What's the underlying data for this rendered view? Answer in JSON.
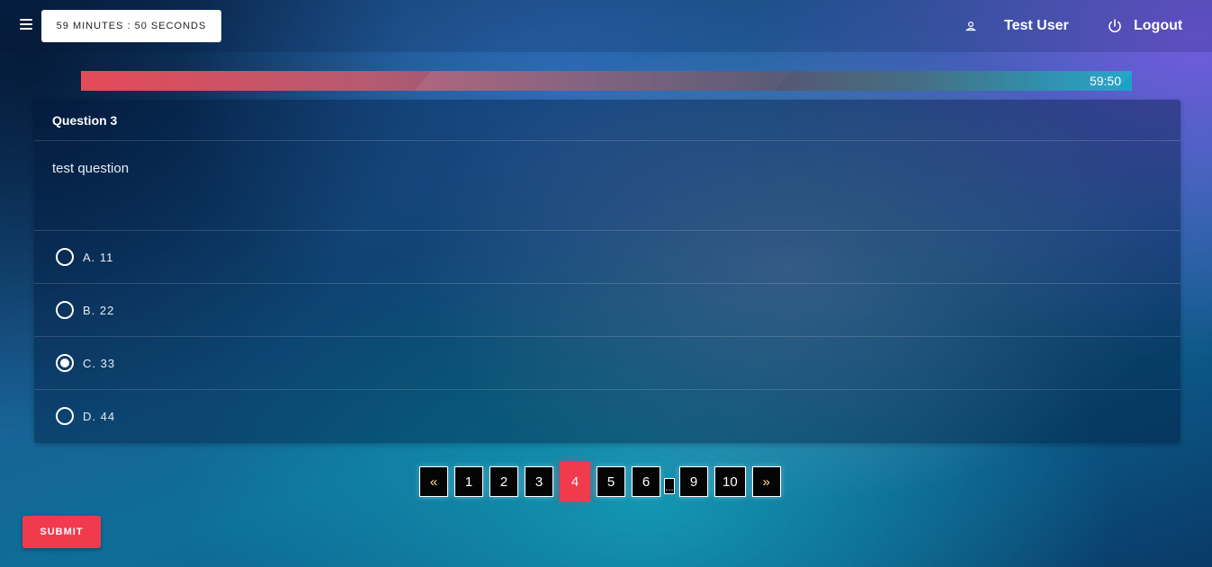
{
  "header": {
    "menu_icon": "hamburger-menu-icon",
    "timer_text": "59 MINUTES : 50 SECONDS",
    "user_icon": "user-icon",
    "user_name": "Test User",
    "logout_icon": "power-icon",
    "logout_label": "Logout"
  },
  "progress": {
    "label": "59:50",
    "fraction": 1.0,
    "colors": {
      "start": "#e64a58",
      "end": "#1aa3c9"
    }
  },
  "question": {
    "title": "Question 3",
    "text": "test question",
    "options": [
      {
        "label": "A. 11",
        "selected": false
      },
      {
        "label": "B. 22",
        "selected": false
      },
      {
        "label": "C. 33",
        "selected": true
      },
      {
        "label": "D. 44",
        "selected": false
      }
    ]
  },
  "pagination": {
    "prev": "«",
    "pages": [
      "1",
      "2",
      "3",
      "4",
      "5",
      "6"
    ],
    "ellipsis": "...",
    "tail_pages": [
      "9",
      "10"
    ],
    "next": "»",
    "active": "4"
  },
  "actions": {
    "submit_label": "SUBMIT"
  },
  "colors": {
    "accent": "#f23a4d",
    "timer_bg": "#ffffff"
  }
}
